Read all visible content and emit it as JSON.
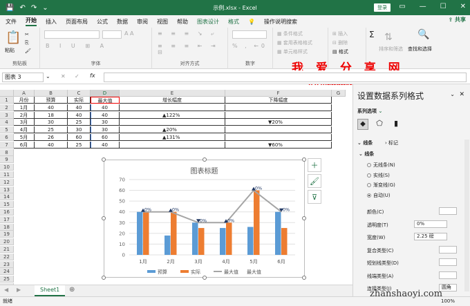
{
  "titlebar": {
    "filename": "示例.xlsx  -  Excel",
    "login": "登录"
  },
  "menu": {
    "items": [
      "文件",
      "开始",
      "插入",
      "页面布局",
      "公式",
      "数据",
      "审阅",
      "视图",
      "帮助",
      "图表设计",
      "格式"
    ],
    "search": "操作说明搜索",
    "share": "共享"
  },
  "ribbon": {
    "clipboard": {
      "paste": "粘贴",
      "label": "剪贴板"
    },
    "font": {
      "label": "字体"
    },
    "align": {
      "label": "对齐方式"
    },
    "number": {
      "label": "数字"
    },
    "styles": {
      "cond": "条件格式",
      "table": "套用表格格式",
      "cell": "单元格样式"
    },
    "cells": {
      "insert": "插入",
      "delete": "删除",
      "format": "格式"
    },
    "editing": {
      "sort": "排序和筛选",
      "find": "查找和选择"
    }
  },
  "watermark": {
    "main": "我 爱 分 享 网",
    "url": "www.zhanshaoyi.com",
    "bottom": "zhanshaoyi.com"
  },
  "formulabar": {
    "namebox": "图表 3",
    "fx": "fx"
  },
  "columns": [
    "A",
    "B",
    "C",
    "D",
    "E",
    "F",
    "G"
  ],
  "table": {
    "headers": [
      "月份",
      "预算",
      "实际",
      "最大值",
      "增长幅度",
      "下降幅度"
    ],
    "rows": [
      [
        "1月",
        "40",
        "40",
        "40",
        "",
        ""
      ],
      [
        "2月",
        "18",
        "40",
        "40",
        "▲122%",
        ""
      ],
      [
        "3月",
        "30",
        "25",
        "30",
        "",
        "▼20%"
      ],
      [
        "4月",
        "25",
        "30",
        "30",
        "▲20%",
        ""
      ],
      [
        "5月",
        "26",
        "60",
        "60",
        "▲131%",
        ""
      ],
      [
        "6月",
        "40",
        "25",
        "40",
        "",
        "▼60%"
      ]
    ]
  },
  "chart_data": {
    "type": "bar",
    "title": "图表标题",
    "categories": [
      "1月",
      "2月",
      "3月",
      "4月",
      "5月",
      "6月"
    ],
    "series": [
      {
        "name": "预算",
        "type": "bar",
        "values": [
          40,
          18,
          30,
          25,
          26,
          40
        ],
        "color": "#5b9bd5"
      },
      {
        "name": "实际",
        "type": "bar",
        "values": [
          40,
          40,
          25,
          30,
          60,
          25
        ],
        "color": "#ed7d31"
      },
      {
        "name": "最大值",
        "type": "line",
        "values": [
          40,
          40,
          30,
          30,
          60,
          40
        ],
        "color": "#a5a5a5"
      }
    ],
    "legend": [
      "预算",
      "实际",
      "最大值",
      "最大值"
    ],
    "ylim": [
      0,
      70
    ],
    "yticks": [
      0,
      10,
      20,
      30,
      40,
      50,
      60,
      70
    ],
    "marker_labels": [
      "0%",
      "0%",
      "0%",
      "0%",
      "0%",
      "0%"
    ],
    "legend_position": "bottom"
  },
  "sheet": {
    "tab": "Sheet1",
    "status": "就绪",
    "zoom": "100%"
  },
  "pane": {
    "title": "设置数据系列格式",
    "subtitle": "系列选项",
    "tab_line": "线条",
    "tab_marker": "标记",
    "section": "线条",
    "radios": [
      "无线条(N)",
      "实线(S)",
      "渐变线(G)",
      "自动(U)"
    ],
    "selected_radio": "自动(U)",
    "props": [
      {
        "label": "颜色(C)",
        "value": ""
      },
      {
        "label": "透明度(T)",
        "value": "0%"
      },
      {
        "label": "宽度(W)",
        "value": "2.25 磅"
      },
      {
        "label": "复合类型(C)",
        "value": ""
      },
      {
        "label": "短划线类型(D)",
        "value": ""
      },
      {
        "label": "线端类型(A)",
        "value": ""
      },
      {
        "label": "连接类型(J)",
        "value": "圆角"
      }
    ]
  }
}
